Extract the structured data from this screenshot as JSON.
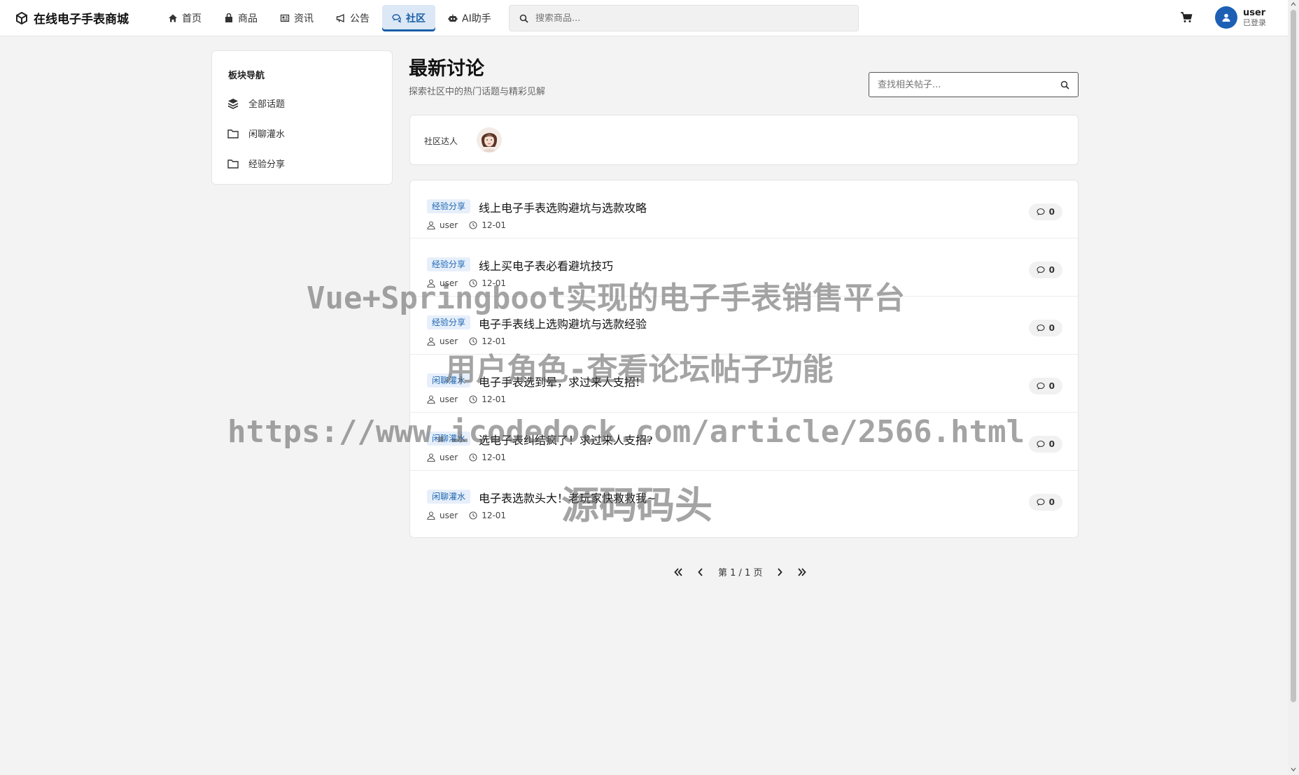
{
  "header": {
    "brand": "在线电子手表商城",
    "nav": [
      {
        "label": "首页",
        "icon": "home-icon"
      },
      {
        "label": "商品",
        "icon": "bag-icon"
      },
      {
        "label": "资讯",
        "icon": "newspaper-icon"
      },
      {
        "label": "公告",
        "icon": "bullhorn-icon"
      },
      {
        "label": "社区",
        "icon": "comments-icon",
        "active": true
      },
      {
        "label": "AI助手",
        "icon": "robot-icon"
      }
    ],
    "search_placeholder": "搜索商品...",
    "user": {
      "name": "user",
      "status": "已登录"
    }
  },
  "sidebar": {
    "title": "板块导航",
    "items": [
      {
        "label": "全部话题",
        "icon": "layers-icon"
      },
      {
        "label": "闲聊灌水",
        "icon": "folder-icon"
      },
      {
        "label": "经验分享",
        "icon": "folder-icon"
      }
    ]
  },
  "main": {
    "title": "最新讨论",
    "subtitle": "探索社区中的热门话题与精彩见解",
    "search_placeholder": "查找相关帖子...",
    "experts_label": "社区达人",
    "posts": [
      {
        "category": "经验分享",
        "title": "线上电子手表选购避坑与选款攻略",
        "author": "user",
        "date": "12-01",
        "comments": "0"
      },
      {
        "category": "经验分享",
        "title": "线上买电子表必看避坑技巧",
        "author": "user",
        "date": "12-01",
        "comments": "0"
      },
      {
        "category": "经验分享",
        "title": "电子手表线上选购避坑与选款经验",
        "author": "user",
        "date": "12-01",
        "comments": "0"
      },
      {
        "category": "闲聊灌水",
        "title": "电子手表选到晕，求过来人支招!",
        "author": "user",
        "date": "12-01",
        "comments": "0"
      },
      {
        "category": "闲聊灌水",
        "title": "选电子表纠结疯了！求过来人支招?",
        "author": "user",
        "date": "12-01",
        "comments": "0"
      },
      {
        "category": "闲聊灌水",
        "title": "电子表选款头大！老玩家快救救我~",
        "author": "user",
        "date": "12-01",
        "comments": "0"
      }
    ],
    "pagination": {
      "text": "第 1 / 1 页"
    }
  },
  "watermark": {
    "line1": "Vue+Springboot实现的电子手表销售平台",
    "line2": "用户角色-查看论坛帖子功能",
    "line3": "https://www.icodedock.com/article/2566.html",
    "line4": "源码码头"
  },
  "colors": {
    "accent": "#1a5fa8",
    "tag_bg": "#e6effa",
    "avatar": "#1d5fb5"
  }
}
